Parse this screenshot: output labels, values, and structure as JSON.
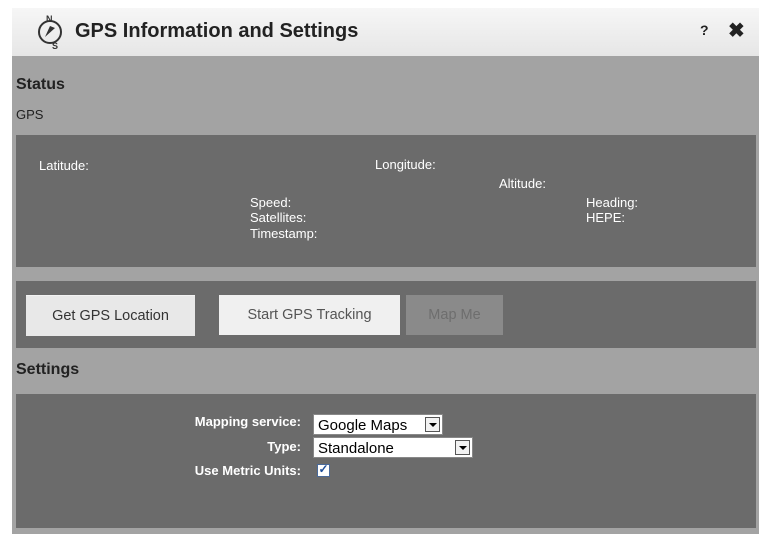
{
  "window": {
    "title": "GPS Information and Settings",
    "help_label": "?",
    "close_label": "✖",
    "icon": "compass-icon",
    "compass_n": "N",
    "compass_s": "S"
  },
  "status": {
    "heading": "Status",
    "subtitle": "GPS",
    "fields": {
      "latitude": "Latitude:",
      "longitude": "Longitude:",
      "altitude": "Altitude:",
      "speed": "Speed:",
      "satellites": "Satellites:",
      "timestamp": "Timestamp:",
      "heading": "Heading:",
      "hepe": "HEPE:"
    }
  },
  "actions": {
    "get_location": "Get GPS Location",
    "start_tracking": "Start GPS Tracking",
    "map_me": "Map Me"
  },
  "settings": {
    "heading": "Settings",
    "mapping_service_label": "Mapping service:",
    "mapping_service_value": "Google Maps",
    "type_label": "Type:",
    "type_value": "Standalone",
    "metric_label": "Use Metric Units:",
    "metric_checked": true,
    "check_glyph": "✓"
  },
  "colors": {
    "panel": "#6b6b6b",
    "background": "#a3a3a3",
    "titlebar": "#eeeeee"
  }
}
